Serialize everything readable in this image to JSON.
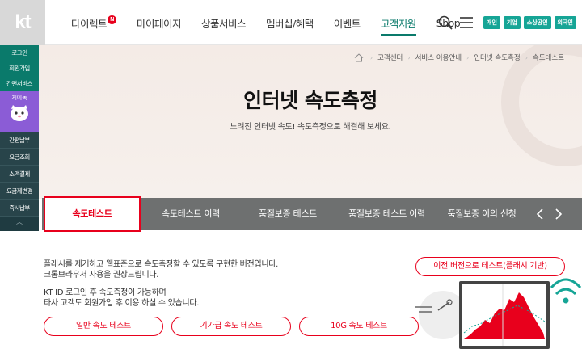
{
  "header": {
    "logo": "kt",
    "nav": [
      {
        "label": "다이렉트",
        "badge": "N"
      },
      {
        "label": "마이페이지"
      },
      {
        "label": "상품서비스"
      },
      {
        "label": "멤버십/혜택"
      },
      {
        "label": "이벤트"
      },
      {
        "label": "고객지원",
        "active": true
      },
      {
        "label": "Shop"
      }
    ],
    "segments": [
      "개인",
      "기업",
      "소상공인",
      "외국인"
    ]
  },
  "quick_menu": {
    "items_top": [
      "로그인",
      "회원가입",
      "간편서비스"
    ],
    "banner_title": "게이독",
    "items_bottom": [
      "간편납부",
      "요금조회",
      "소액결제",
      "요금제변경",
      "즉시납부"
    ]
  },
  "breadcrumb": [
    "고객센터",
    "서비스 이용안내",
    "인터넷 속도측정",
    "속도테스트"
  ],
  "page": {
    "title": "인터넷 속도측정",
    "subtitle": "느려진 인터넷 속도! 속도측정으로 해결해 보세요."
  },
  "tabs": [
    "속도테스트",
    "속도테스트 이력",
    "품질보증 테스트",
    "품질보증 테스트 이력",
    "품질보증 이의 신청"
  ],
  "content": {
    "desc1_line1": "플래시를 제거하고 웹표준으로 속도측정할 수 있도록 구현한 버전입니다.",
    "desc1_line2": "크롬브라우저 사용을 권장드립니다.",
    "desc2_line1": "KT ID 로그인 후 속도측정이 가능하며",
    "desc2_line2": "타사 고객도 회원가입 후 이용 하실 수 있습니다.",
    "prev_version_btn": "이전 버전으로 테스트(플래시 기반)",
    "test_buttons": [
      "일반 속도 테스트",
      "기가급 속도 테스트",
      "10G 속도 테스트"
    ]
  },
  "colors": {
    "accent": "#e8001c",
    "brand": "#16a596",
    "tabbar": "#6e7070"
  }
}
